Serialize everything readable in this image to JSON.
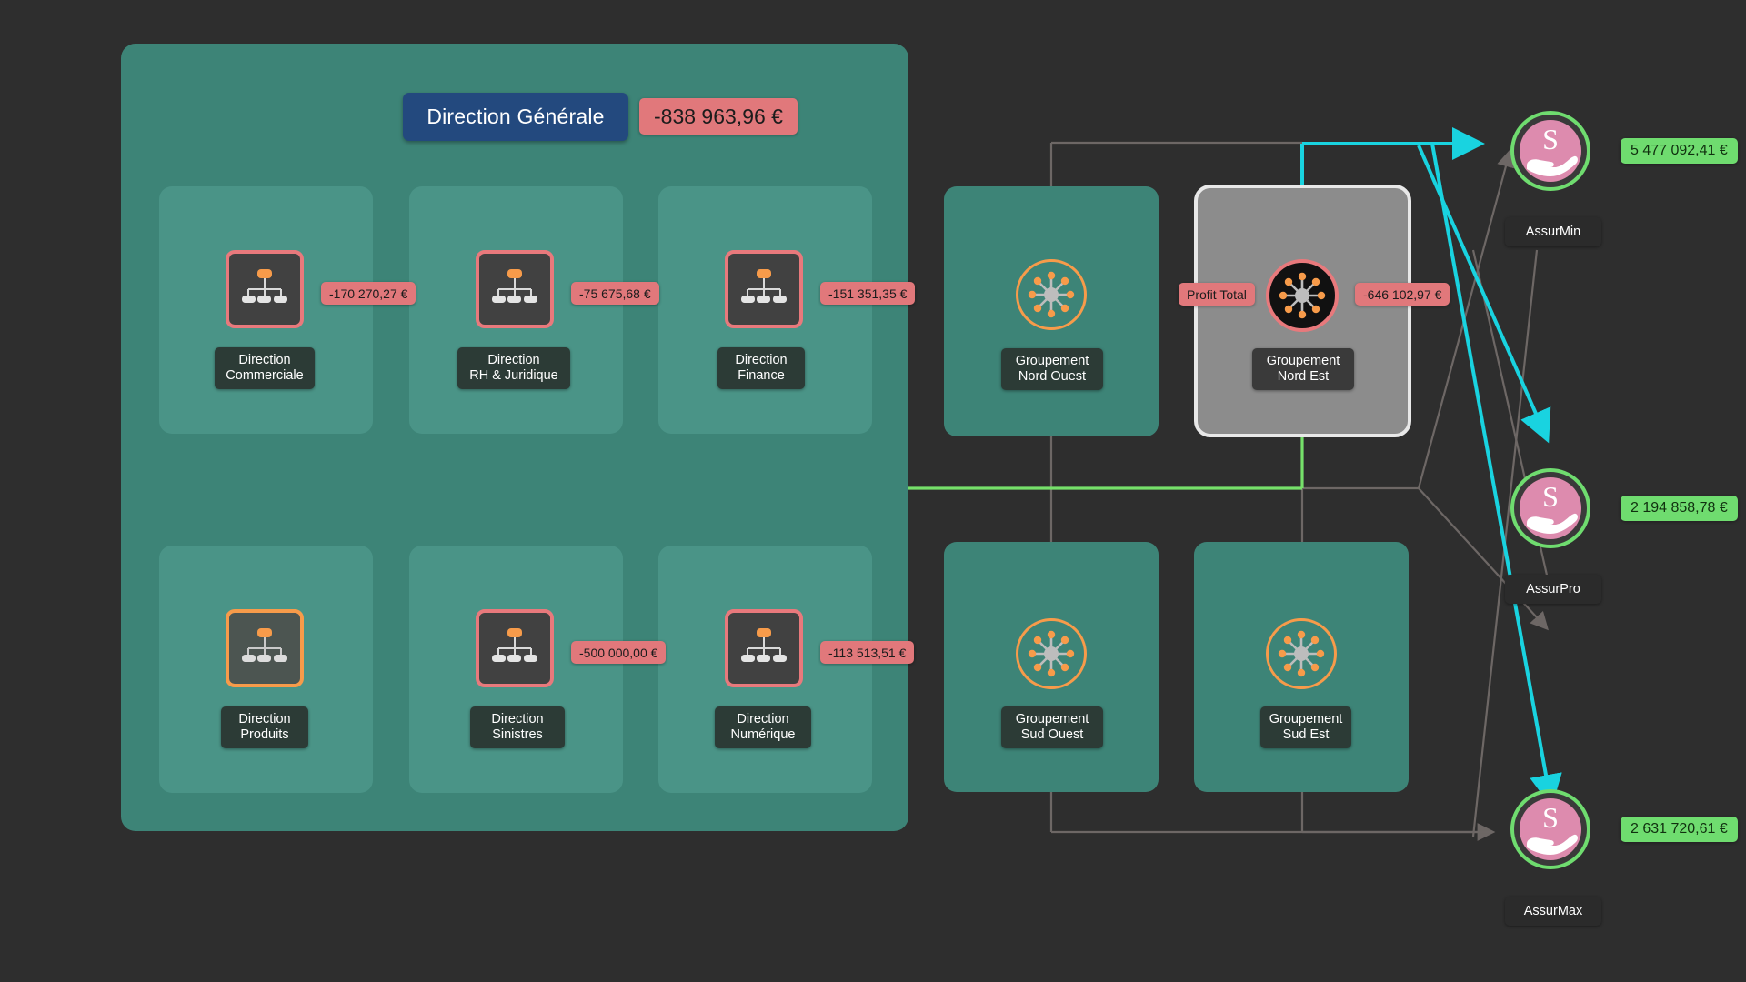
{
  "root": {
    "title": "Direction Générale",
    "total_value": "-838 963,96 €"
  },
  "departments": [
    {
      "name_line1": "Direction",
      "name_line2": "Commerciale",
      "value": "-170 270,27 €",
      "icon": "org-chart-icon",
      "state": "negative"
    },
    {
      "name_line1": "Direction",
      "name_line2": "RH & Juridique",
      "value": "-75 675,68 €",
      "icon": "org-chart-icon",
      "state": "negative"
    },
    {
      "name_line1": "Direction",
      "name_line2": "Finance",
      "value": "-151 351,35 €",
      "icon": "org-chart-icon",
      "state": "negative"
    },
    {
      "name_line1": "Direction",
      "name_line2": "Produits",
      "value": "",
      "icon": "org-chart-icon",
      "state": "neutral"
    },
    {
      "name_line1": "Direction",
      "name_line2": "Sinistres",
      "value": "-500 000,00 €",
      "icon": "org-chart-icon",
      "state": "negative"
    },
    {
      "name_line1": "Direction",
      "name_line2": "Numérique",
      "value": "-113 513,51 €",
      "icon": "org-chart-icon",
      "state": "negative"
    }
  ],
  "regions": [
    {
      "name_line1": "Groupement",
      "name_line2": "Nord Ouest",
      "value": "",
      "profit_label": "",
      "icon": "hub-network-icon",
      "selected": false
    },
    {
      "name_line1": "Groupement",
      "name_line2": "Nord Est",
      "value": "-646 102,97 €",
      "profit_label": "Profit Total",
      "icon": "hub-network-icon",
      "selected": true
    },
    {
      "name_line1": "Groupement",
      "name_line2": "Sud Ouest",
      "value": "",
      "profit_label": "",
      "icon": "hub-network-icon",
      "selected": false
    },
    {
      "name_line1": "Groupement",
      "name_line2": "Sud Est",
      "value": "",
      "profit_label": "",
      "icon": "hub-network-icon",
      "selected": false
    }
  ],
  "insurers": [
    {
      "name": "AssurMin",
      "value": "5 477 092,41 €",
      "icon": "insurance-hand-icon"
    },
    {
      "name": "AssurPro",
      "value": "2 194 858,78 €",
      "icon": "insurance-hand-icon"
    },
    {
      "name": "AssurMax",
      "value": "2 631 720,61 €",
      "icon": "insurance-hand-icon"
    }
  ],
  "colors": {
    "canvas_background": "#2e2e2e",
    "group_panel": "#3d8477",
    "dept_card": "#4a9487",
    "root_title": "#23497e",
    "negative_badge": "#e1787b",
    "positive_badge": "#6fdc6f",
    "accent_orange": "#f79b4a",
    "highlight_cyan": "#19d3e0",
    "flow_green": "#76e06a",
    "edge_grey": "#6d6765",
    "selected_panel": "#8c8c8c"
  }
}
